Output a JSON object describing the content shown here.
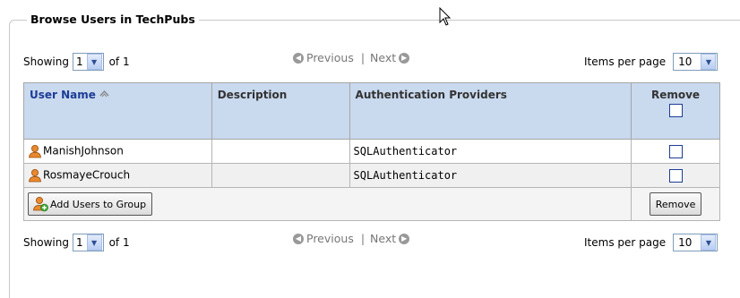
{
  "panel": {
    "title": "Browse Users in TechPubs"
  },
  "pager_top": {
    "showing_label": "Showing",
    "page_value": "1",
    "of_label": "of 1",
    "previous_label": "Previous",
    "separator": "|",
    "next_label": "Next",
    "items_per_page_label": "Items per page",
    "items_per_page_value": "10"
  },
  "pager_bottom": {
    "showing_label": "Showing",
    "page_value": "1",
    "of_label": "of 1",
    "previous_label": "Previous",
    "separator": "|",
    "next_label": "Next",
    "items_per_page_label": "Items per page",
    "items_per_page_value": "10"
  },
  "table": {
    "columns": {
      "user_name": "User Name",
      "description": "Description",
      "auth_providers": "Authentication Providers",
      "remove": "Remove"
    },
    "rows": [
      {
        "user": "ManishJohnson",
        "description": "",
        "provider": "SQLAuthenticator"
      },
      {
        "user": "RosmayeCrouch",
        "description": "",
        "provider": "SQLAuthenticator"
      }
    ],
    "add_button": "Add Users to Group",
    "remove_button": "Remove"
  },
  "icons": {
    "sort": "sort-ascending-icon",
    "user": "user-icon",
    "add_user": "add-user-icon",
    "previous": "previous-icon",
    "next": "next-icon"
  },
  "colors": {
    "header_bg": "#c9d9ee",
    "link_blue": "#1c3c96"
  }
}
